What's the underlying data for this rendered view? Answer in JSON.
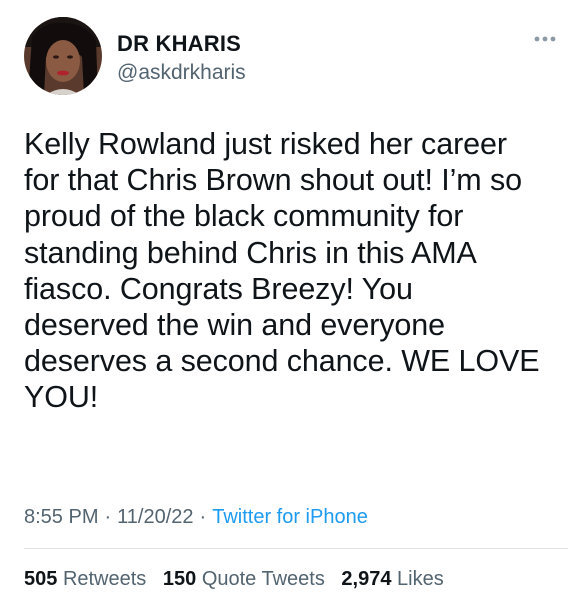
{
  "author": {
    "display_name": "DR KHARIS",
    "handle": "@askdrkharis",
    "avatar_icon": "profile-photo"
  },
  "more_icon": "ellipsis-icon",
  "tweet": {
    "text": "Kelly Rowland just risked her career\nfor that Chris Brown shout out! I’m so\nproud of the black community for\nstanding behind Chris in this AMA\nfiasco. Congrats Breezy! You\ndeserved the win and everyone\ndeserves a second chance. WE LOVE\nYOU!",
    "time": "8:55 PM",
    "separator": "·",
    "date": "11/20/22",
    "source": "Twitter for iPhone"
  },
  "stats": {
    "retweets": {
      "count": "505",
      "label": "Retweets"
    },
    "quote_tweets": {
      "count": "150",
      "label": "Quote Tweets"
    },
    "likes": {
      "count": "2,974",
      "label": "Likes"
    }
  },
  "colors": {
    "text": "#0f1419",
    "secondary": "#536471",
    "link": "#1d9bf0"
  }
}
